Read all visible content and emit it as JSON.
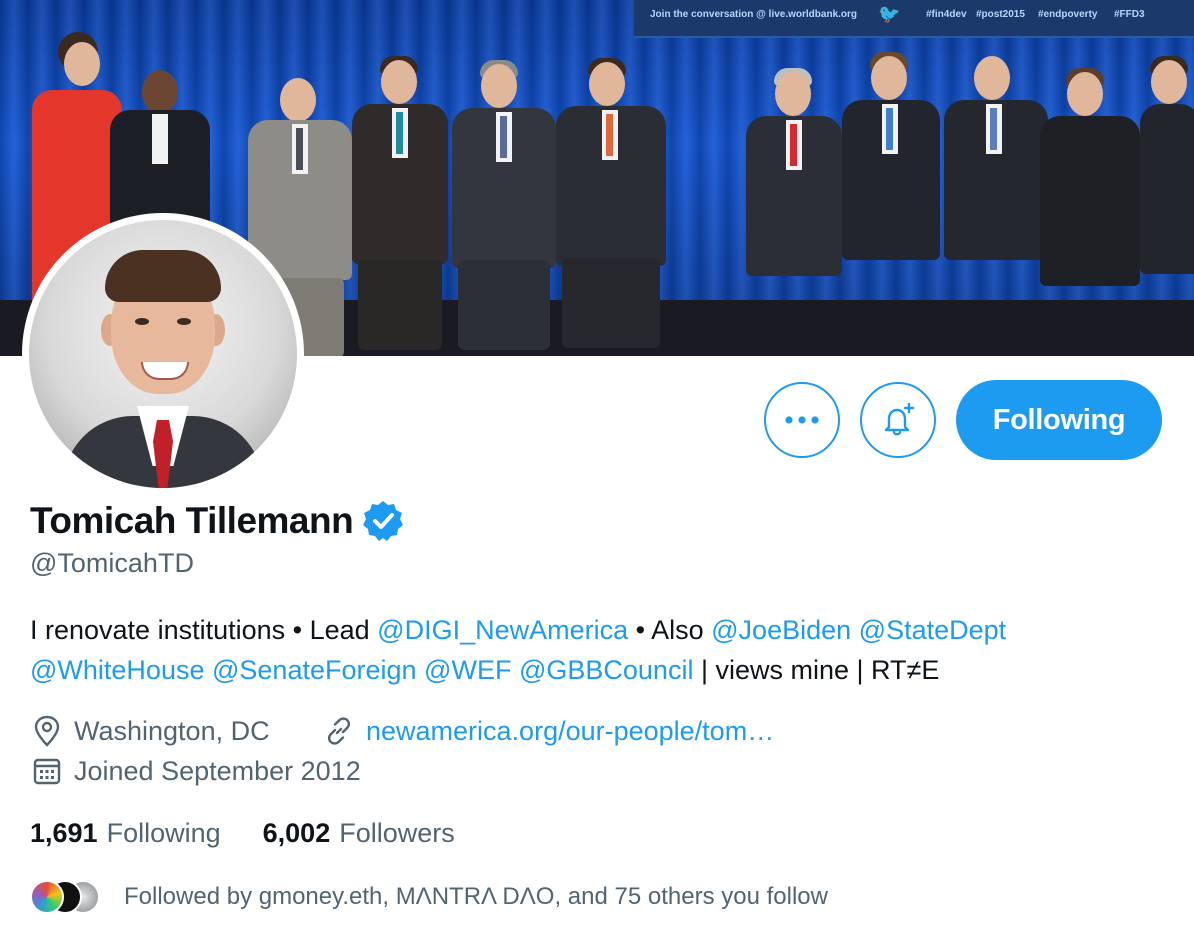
{
  "banner": {
    "screen_texts": [
      "Join the conversation @ live.worldbank.org",
      "#fin4dev",
      "#post2015",
      "#endpoverty",
      "#FFD3"
    ]
  },
  "actions": {
    "more_icon": "more-horizontal-icon",
    "bell_icon": "bell-plus-icon",
    "following_label": "Following"
  },
  "profile": {
    "display_name": "Tomicah Tillemann",
    "verified_icon": "verified-badge-icon",
    "handle": "@TomicahTD",
    "bio": {
      "line1": [
        {
          "text": "I renovate institutions • Lead ",
          "type": "text"
        },
        {
          "text": "@DIGI_NewAmerica",
          "type": "mention"
        },
        {
          "text": " • Also ",
          "type": "text"
        },
        {
          "text": "@JoeBiden",
          "type": "mention"
        },
        {
          "text": " ",
          "type": "text"
        },
        {
          "text": "@StateDept",
          "type": "mention"
        }
      ],
      "line2": [
        {
          "text": "@WhiteHouse",
          "type": "mention"
        },
        {
          "text": " ",
          "type": "text"
        },
        {
          "text": "@SenateForeign",
          "type": "mention"
        },
        {
          "text": " ",
          "type": "text"
        },
        {
          "text": "@WEF",
          "type": "mention"
        },
        {
          "text": " ",
          "type": "text"
        },
        {
          "text": "@GBBCouncil",
          "type": "mention"
        },
        {
          "text": " | views mine | RT≠E",
          "type": "text"
        }
      ]
    },
    "location": "Washington, DC",
    "location_icon": "location-pin-icon",
    "website": "newamerica.org/our-people/tom…",
    "website_icon": "link-icon",
    "joined": "Joined September 2012",
    "joined_icon": "calendar-icon"
  },
  "stats": {
    "following_count": "1,691",
    "following_label": "Following",
    "followers_count": "6,002",
    "followers_label": "Followers"
  },
  "followed_by": {
    "text": "Followed by gmoney.eth, MΛNTRΛ DΛO, and 75 others you follow"
  },
  "colors": {
    "accent": "#1d9bf0",
    "text_primary": "#0f1419",
    "text_secondary": "#536471"
  }
}
